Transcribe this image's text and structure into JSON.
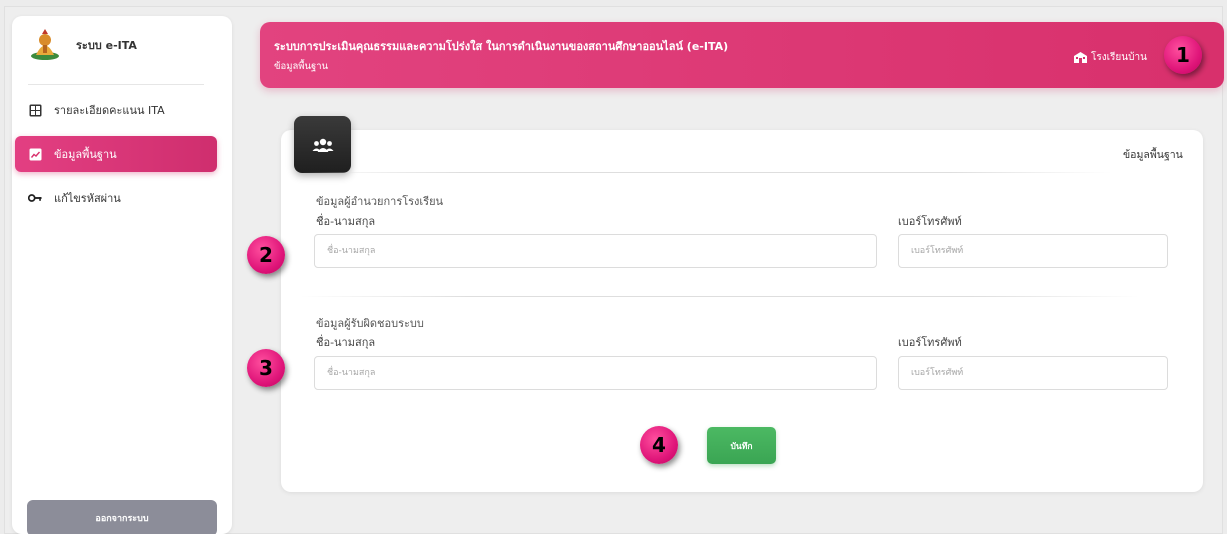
{
  "sidebar": {
    "brand": "ระบบ e-ITA",
    "items": [
      {
        "label": "รายละเอียดคะแนน ITA",
        "icon": "table-icon",
        "active": false
      },
      {
        "label": "ข้อมูลพื้นฐาน",
        "icon": "chart-icon",
        "active": true
      },
      {
        "label": "แก้ไขรหัสผ่าน",
        "icon": "key-icon",
        "active": false
      }
    ],
    "logout_label": "ออกจากระบบ"
  },
  "header": {
    "title": "ระบบการประเมินคุณธรรมและความโปร่งใส ในการดำเนินงานของสถานศึกษาออนไลน์ (e-ITA)",
    "subtitle": "ข้อมูลพื้นฐาน",
    "school_link": "โรงเรียนบ้าน"
  },
  "card": {
    "heading": "ข้อมูลพื้นฐาน",
    "director": {
      "section_title": "ข้อมูลผู้อำนวยการโรงเรียน",
      "name_label": "ชื่อ-นามสกุล",
      "name_placeholder": "ชื่อ-นามสกุล",
      "name_value": "",
      "phone_label": "เบอร์โทรศัพท์",
      "phone_placeholder": "เบอร์โทรศัพท์",
      "phone_value": ""
    },
    "admin": {
      "section_title": "ข้อมูลผู้รับผิดชอบระบบ",
      "name_label": "ชื่อ-นามสกุล",
      "name_placeholder": "ชื่อ-นามสกุล",
      "name_value": "",
      "phone_label": "เบอร์โทรศัพท์",
      "phone_placeholder": "เบอร์โทรศัพท์",
      "phone_value": ""
    },
    "save_label": "บันทึก"
  },
  "markers": [
    "1",
    "2",
    "3",
    "4"
  ],
  "colors": {
    "accent": "#d8306c",
    "save": "#3aa553",
    "logout": "#8c8d99",
    "marker": "#e0167a"
  }
}
